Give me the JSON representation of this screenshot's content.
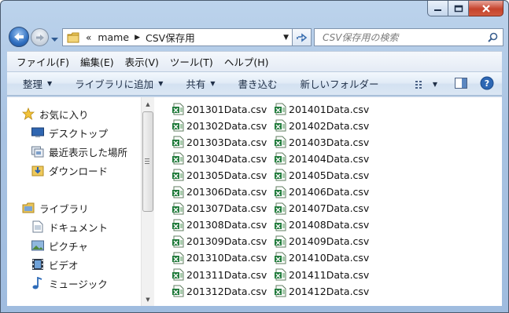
{
  "window": {
    "minimize_glyph": "minimize-icon",
    "maximize_glyph": "maximize-icon",
    "close_glyph": "close-icon"
  },
  "address": {
    "overflow": "«",
    "crumbs": [
      "mame",
      "CSV保存用"
    ],
    "arrow": "▶",
    "dropdown": "▼"
  },
  "search": {
    "placeholder": "CSV保存用の検索"
  },
  "menu": [
    "ファイル(F)",
    "編集(E)",
    "表示(V)",
    "ツール(T)",
    "ヘルプ(H)"
  ],
  "commands": {
    "organize": "整理",
    "add_to_library": "ライブラリに追加",
    "share": "共有",
    "burn": "書き込む",
    "new_folder": "新しいフォルダー",
    "caret": "▼"
  },
  "nav": {
    "favorites": {
      "label": "お気に入り",
      "items": [
        "デスクトップ",
        "最近表示した場所",
        "ダウンロード"
      ]
    },
    "libraries": {
      "label": "ライブラリ",
      "items": [
        "ドキュメント",
        "ピクチャ",
        "ビデオ",
        "ミュージック"
      ]
    }
  },
  "files": [
    "201301Data.csv",
    "201302Data.csv",
    "201303Data.csv",
    "201304Data.csv",
    "201305Data.csv",
    "201306Data.csv",
    "201307Data.csv",
    "201308Data.csv",
    "201309Data.csv",
    "201310Data.csv",
    "201311Data.csv",
    "201312Data.csv",
    "201401Data.csv",
    "201402Data.csv",
    "201403Data.csv",
    "201404Data.csv",
    "201405Data.csv",
    "201406Data.csv",
    "201407Data.csv",
    "201408Data.csv",
    "201409Data.csv",
    "201410Data.csv",
    "201411Data.csv",
    "201412Data.csv"
  ],
  "colors": {
    "chrome": "#a9c3e2",
    "close_button": "#c5432c",
    "excel_green": "#1f7a3a"
  }
}
